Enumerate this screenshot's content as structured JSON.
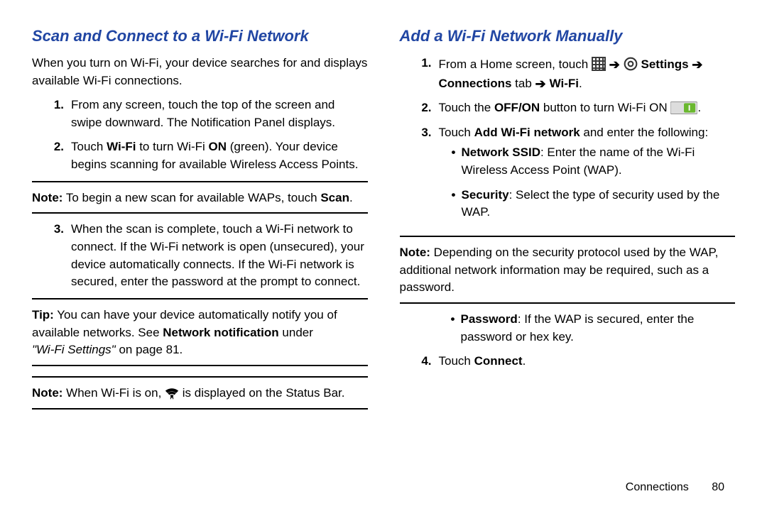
{
  "left": {
    "heading": "Scan and Connect to a Wi-Fi Network",
    "intro": "When you turn on Wi-Fi, your device searches for and displays available Wi-Fi connections.",
    "step1": "From any screen, touch the top of the screen and swipe downward. The Notification Panel displays.",
    "step2_a": "Touch ",
    "step2_wifi": "Wi-Fi",
    "step2_b": " to turn Wi-Fi ",
    "step2_on": "ON",
    "step2_c": " (green). Your device begins scanning for available Wireless Access Points.",
    "note1_lbl": "Note:",
    "note1_a": " To begin a new scan for available WAPs, touch ",
    "note1_scan": "Scan",
    "note1_b": ".",
    "step3": "When the scan is complete, touch a Wi-Fi network to connect. If the Wi-Fi network is open (unsecured), your device automatically connects. If the Wi-Fi network is secured, enter the password at the prompt to connect.",
    "tip_lbl": "Tip:",
    "tip_a": " You can have your device automatically notify you of available networks. See ",
    "tip_b": "Network notification",
    "tip_c": " under ",
    "tip_d": "\"Wi-Fi Settings\"",
    "tip_e": " on page 81.",
    "note2_lbl": "Note:",
    "note2_a": " When Wi-Fi is on, ",
    "note2_b": " is displayed on the Status Bar."
  },
  "right": {
    "heading": "Add a Wi-Fi Network Manually",
    "s1_a": "From a Home screen, touch ",
    "s1_settings": "Settings",
    "s1_conn": "Connections",
    "s1_tab": " tab ",
    "s1_wifi": "Wi-Fi",
    "s1_dot": ".",
    "s2_a": "Touch the ",
    "s2_off": "OFF/ON",
    "s2_b": " button to turn Wi-Fi ON ",
    "s2_dot": ".",
    "s3_a": "Touch ",
    "s3_add": "Add Wi-Fi network",
    "s3_b": " and enter the following:",
    "bul1_lbl": "Network SSID",
    "bul1_txt": ": Enter the name of the Wi-Fi Wireless Access Point (WAP).",
    "bul2_lbl": "Security",
    "bul2_txt": ": Select the type of security used by the WAP.",
    "note_lbl": "Note:",
    "note_txt": " Depending on the security protocol used by the WAP, additional network information may be required, such as a password.",
    "bul3_lbl": "Password",
    "bul3_txt": ": If the WAP is secured, enter the password or hex key.",
    "s4_a": "Touch ",
    "s4_connect": "Connect",
    "s4_dot": "."
  },
  "footer": {
    "section": "Connections",
    "page": "80"
  },
  "icons": {
    "apps": "apps-grid-icon",
    "gear": "settings-gear-icon",
    "wifi": "wifi-icon",
    "toggle": "toggle-on-icon"
  }
}
